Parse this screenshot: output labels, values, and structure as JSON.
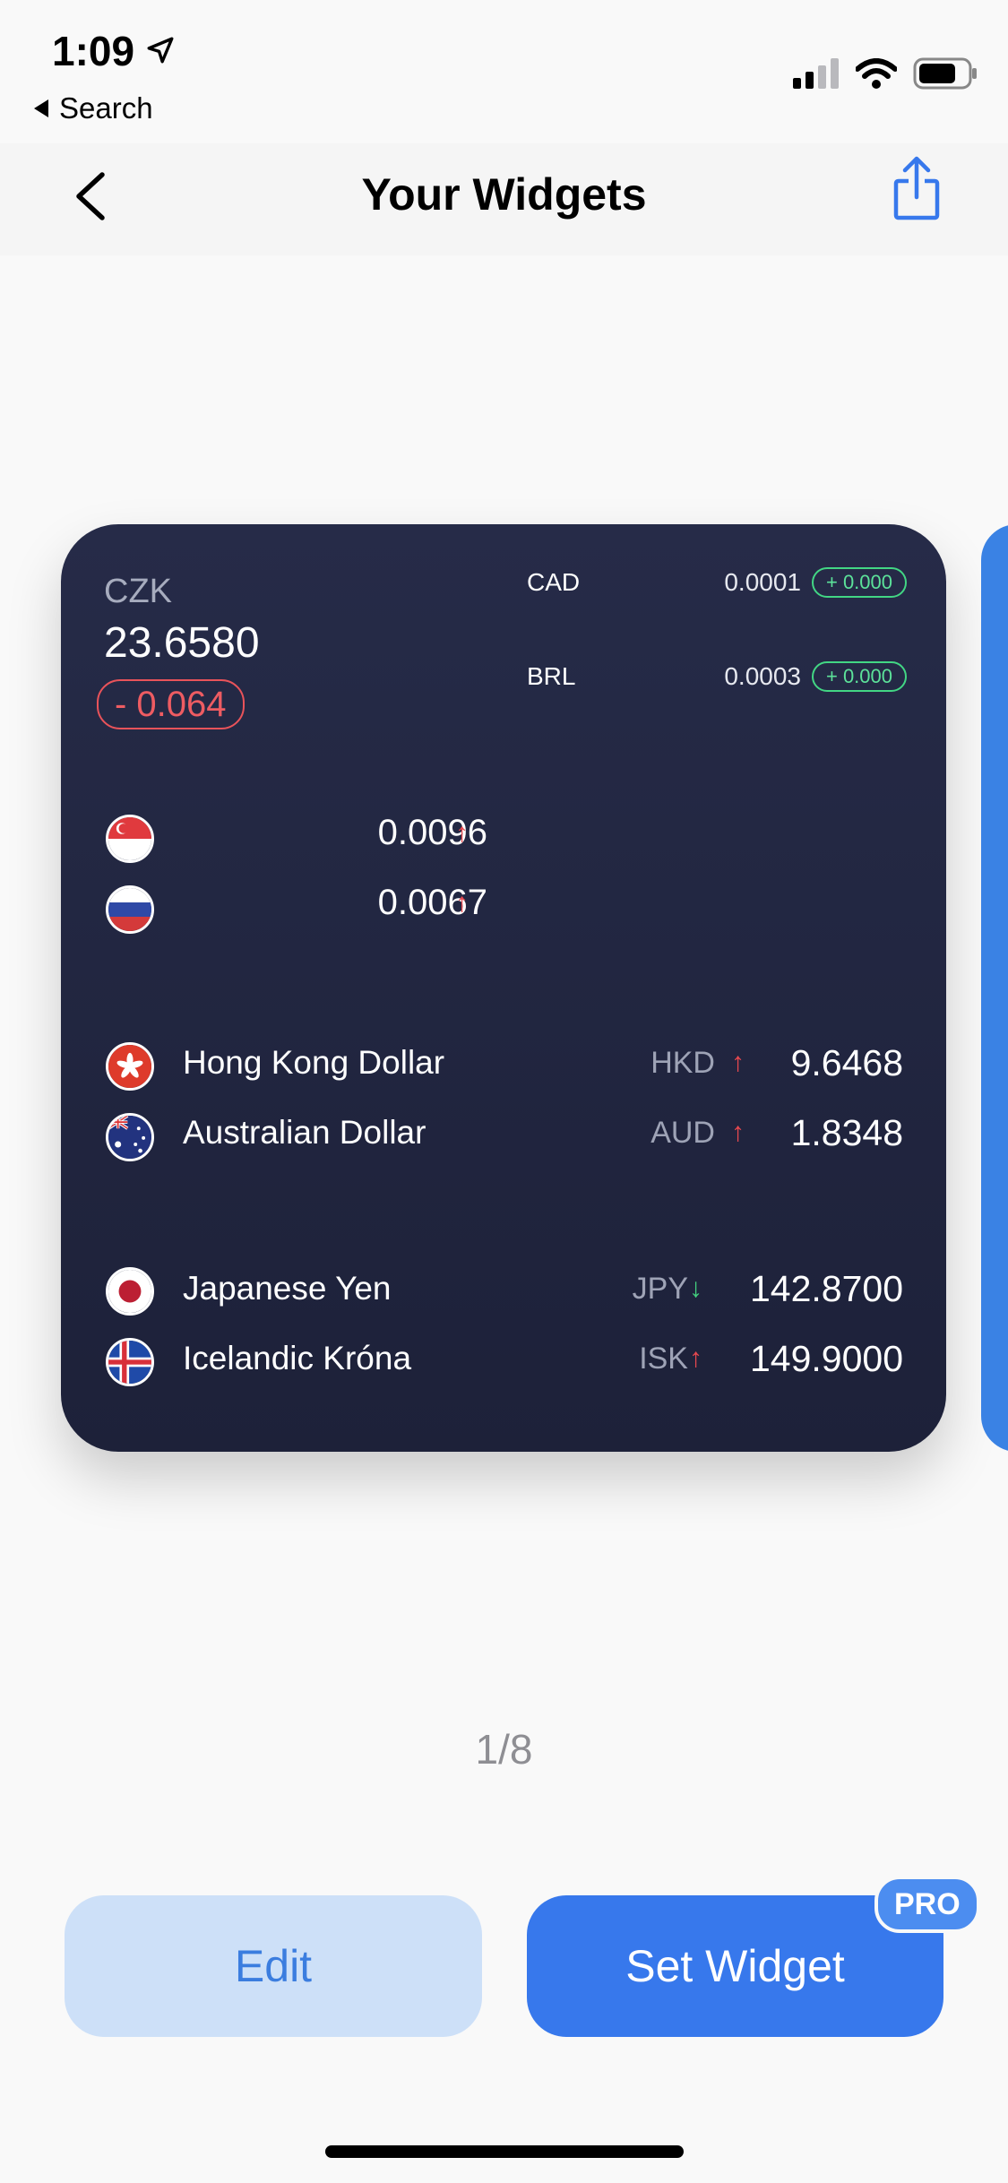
{
  "status_bar": {
    "time": "1:09",
    "back_app": "Search",
    "icons": [
      "location-arrow-icon",
      "cellular-signal-icon",
      "wifi-icon",
      "battery-icon"
    ]
  },
  "nav": {
    "title": "Your Widgets",
    "back_icon": "chevron-left-icon",
    "share_icon": "share-icon"
  },
  "widget": {
    "primary": {
      "code": "CZK",
      "rate": "23.6580",
      "change": "- 0.064"
    },
    "mini_rows": [
      {
        "code": "CAD",
        "rate": "0.0001",
        "change": "+ 0.000"
      },
      {
        "code": "BRL",
        "rate": "0.0003",
        "change": "+ 0.000"
      }
    ],
    "flag_rows": [
      {
        "flag": "singapore-flag",
        "rate": "0.0096",
        "trend": "up"
      },
      {
        "flag": "russia-flag",
        "rate": "0.0067",
        "trend": "up"
      }
    ],
    "currencies_a": [
      {
        "flag": "hong-kong-flag",
        "name": "Hong Kong Dollar",
        "code": "HKD",
        "trend": "up",
        "rate": "9.6468"
      },
      {
        "flag": "australia-flag",
        "name": "Australian Dollar",
        "code": "AUD",
        "trend": "up",
        "rate": "1.8348"
      }
    ],
    "currencies_b": [
      {
        "flag": "japan-flag",
        "name": "Japanese Yen",
        "code": "JPY",
        "trend": "down",
        "rate": "142.8700"
      },
      {
        "flag": "iceland-flag",
        "name": "Icelandic Króna",
        "code": "ISK",
        "trend": "up",
        "rate": "149.9000"
      }
    ],
    "arrow_up": "↑",
    "arrow_down": "↓"
  },
  "pager": "1/8",
  "buttons": {
    "edit": "Edit",
    "set_widget": "Set Widget",
    "pro_badge": "PRO"
  },
  "colors": {
    "accent": "#3778ec",
    "card_bg": "#232741",
    "up": "#e6484f",
    "down": "#43d07f"
  }
}
